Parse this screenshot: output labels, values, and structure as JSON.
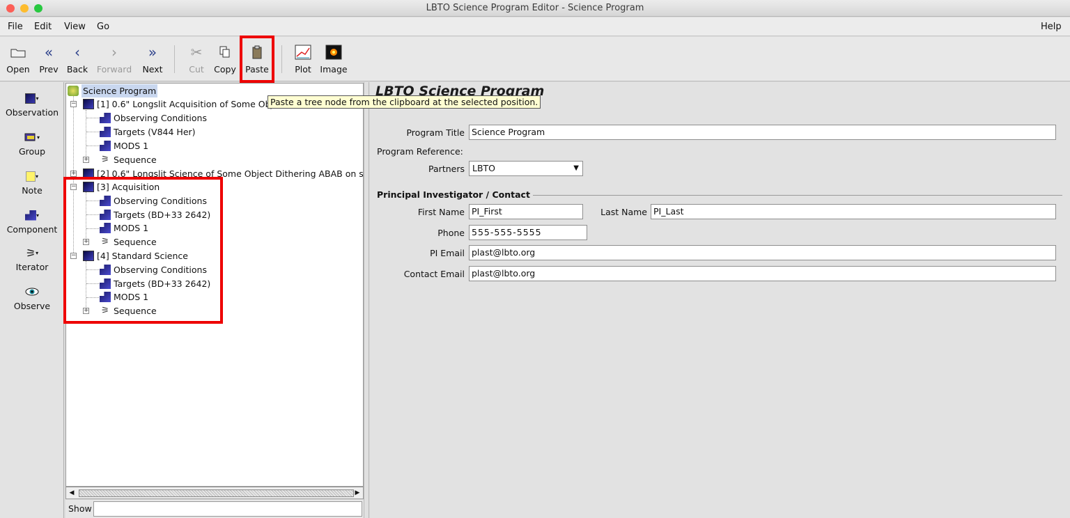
{
  "window": {
    "title": "LBTO Science Program Editor - Science Program"
  },
  "menu": {
    "file": "File",
    "edit": "Edit",
    "view": "View",
    "go": "Go",
    "help": "Help"
  },
  "toolbar": {
    "open": "Open",
    "prev": "Prev",
    "back": "Back",
    "forward": "Forward",
    "next": "Next",
    "cut": "Cut",
    "copy": "Copy",
    "paste": "Paste",
    "plot": "Plot",
    "image": "Image"
  },
  "tooltip": "Paste a tree node from the clipboard at the selected position.",
  "palette": {
    "observation": "Observation",
    "group": "Group",
    "note": "Note",
    "component": "Component",
    "iterator": "Iterator",
    "observe": "Observe"
  },
  "tree": {
    "root": "Science Program",
    "obs1": {
      "label": "[1] 0.6\" Longslit Acquisition of Some Obj",
      "conditions": "Observing Conditions",
      "targets": "Targets (V844 Her)",
      "mods": "MODS 1",
      "sequence": "Sequence"
    },
    "obs2": {
      "label": "[2] 0.6\" Longslit Science of Some Object Dithering ABAB on s"
    },
    "obs3": {
      "label": "[3] Acquisition",
      "conditions": "Observing Conditions",
      "targets": "Targets (BD+33 2642)",
      "mods": "MODS 1",
      "sequence": "Sequence"
    },
    "obs4": {
      "label": "[4] Standard Science",
      "conditions": "Observing Conditions",
      "targets": "Targets (BD+33 2642)",
      "mods": "MODS 1",
      "sequence": "Sequence"
    }
  },
  "show": {
    "label": "Show",
    "value": ""
  },
  "form": {
    "heading": "LBTO Science Program",
    "program_title_label": "Program Title",
    "program_title": "Science Program",
    "program_reference_label": "Program Reference:",
    "partners_label": "Partners",
    "partners": "LBTO",
    "section": "Principal Investigator / Contact",
    "first_name_label": "First Name",
    "first_name": "PI_First",
    "last_name_label": "Last Name",
    "last_name": "PI_Last",
    "phone_label": "Phone",
    "phone": "555-555-5555",
    "pi_email_label": "PI Email",
    "pi_email": "plast@lbto.org",
    "contact_email_label": "Contact Email",
    "contact_email": "plast@lbto.org"
  },
  "colors": {
    "highlight": "#ee0000",
    "tooltip_bg": "#fffed2",
    "selection": "#c9d7ef"
  }
}
